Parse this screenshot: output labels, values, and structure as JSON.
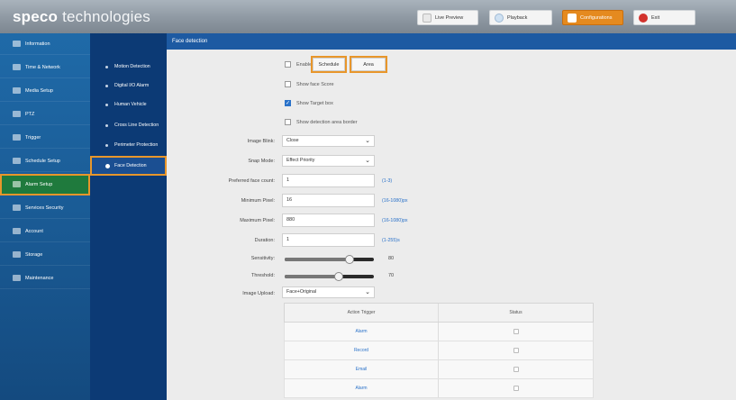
{
  "header": {
    "logo_bold": "speco",
    "logo_light": "technologies",
    "buttons": {
      "live_preview": "Live Preview",
      "playback": "Playback",
      "configurations": "Configurations",
      "exit": "Exit"
    }
  },
  "nav": {
    "primary": [
      "Information",
      "Time & Network",
      "Media Setup",
      "PTZ",
      "Trigger",
      "Schedule Setup",
      "Alarm Setup",
      "Services Security",
      "Account",
      "Storage",
      "Maintenance"
    ],
    "primary_active": "Alarm Setup",
    "secondary": [
      "Motion Detection",
      "Digital I/O Alarm",
      "Human Vehicle",
      "Cross Line Detection",
      "Perimeter Protection",
      "Face Detection"
    ],
    "secondary_active": "Face Detection"
  },
  "page": {
    "title": "Face detection",
    "enable_label": "Enable",
    "enable_checked": false,
    "schedule_button": "Schedule",
    "area_button": "Area",
    "show_face_score": "Show face Score",
    "show_face_score_checked": false,
    "show_target_box": "Show Target box",
    "show_target_box_checked": true,
    "show_detection_border": "Show detection area border",
    "show_detection_border_checked": false,
    "image_blink_label": "Image Blink:",
    "image_blink_value": "Close",
    "snap_mode_label": "Snap Mode:",
    "snap_mode_value": "Effect Priority",
    "preferred_face_count_label": "Preferred face count:",
    "preferred_face_count_value": "1",
    "preferred_face_count_unit": "(1-3)",
    "minimum_pixel_label": "Minimum Pixel:",
    "minimum_pixel_value": "16",
    "minimum_pixel_unit": "(16-1080)px",
    "maximum_pixel_label": "Maximum Pixel:",
    "maximum_pixel_value": "880",
    "maximum_pixel_unit": "(16-1080)px",
    "duration_label": "Duration:",
    "duration_value": "1",
    "duration_unit": "(1-255)s",
    "sensitivity_label": "Sensitivity:",
    "sensitivity_value": "80",
    "threshold_label": "Threshold:",
    "threshold_value": "70",
    "image_upload_label": "Image Upload:",
    "image_upload_value": "Face+Original"
  },
  "trigger_table": {
    "headers": [
      "Action Trigger",
      "Status"
    ],
    "rows": [
      {
        "name": "Alarm",
        "status": false
      },
      {
        "name": "Record",
        "status": false
      },
      {
        "name": "Email",
        "status": false
      },
      {
        "name": "Alarm",
        "status": false
      }
    ]
  }
}
